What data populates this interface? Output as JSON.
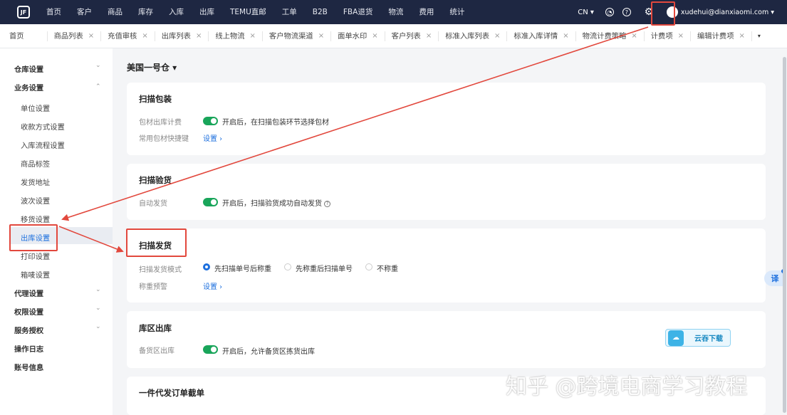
{
  "nav": {
    "logo_text": "JF",
    "items": [
      "首页",
      "客户",
      "商品",
      "库存",
      "入库",
      "出库",
      "TEMU直邮",
      "工单",
      "B2B",
      "FBA退货",
      "物流",
      "费用",
      "统计"
    ],
    "lang": "CN ▾",
    "user_email": "xudehui@dianxiaomi.com ▾"
  },
  "tabs": {
    "home": "首页",
    "items": [
      "商品列表",
      "充值审核",
      "出库列表",
      "线上物流",
      "客户物流渠道",
      "面单水印",
      "客户列表",
      "标准入库列表",
      "标准入库详情",
      "物流计费策略",
      "计费项",
      "编辑计费项"
    ],
    "close": "×",
    "more": "▾"
  },
  "sidebar": {
    "groups": {
      "warehouse": "仓库设置",
      "business": "业务设置",
      "agent": "代理设置",
      "permission": "权限设置",
      "service": "服务授权",
      "log": "操作日志",
      "account": "账号信息"
    },
    "business_items": [
      "单位设置",
      "收款方式设置",
      "入库流程设置",
      "商品标签",
      "发货地址",
      "波次设置",
      "移货设置",
      "出库设置",
      "打印设置",
      "箱唛设置"
    ],
    "chevron_down": "⌄",
    "chevron_up": "⌃"
  },
  "main": {
    "warehouse_select": "美国一号仓 ▾",
    "scan_pack": {
      "title": "扫描包装",
      "row1_label": "包材出库计费",
      "row1_text": "开启后，在扫描包装环节选择包材",
      "row2_label": "常用包材快捷键",
      "row2_link": "设置 ›"
    },
    "scan_check": {
      "title": "扫描验货",
      "row1_label": "自动发货",
      "row1_text": "开启后，扫描验货成功自动发货",
      "help": "?"
    },
    "scan_ship": {
      "title": "扫描发货",
      "mode_label": "扫描发货模式",
      "options": [
        "先扫描单号后称重",
        "先称重后扫描单号",
        "不称重"
      ],
      "selected": 0,
      "weight_label": "称重预警",
      "weight_link": "设置 ›"
    },
    "zone_out": {
      "title": "库区出库",
      "row1_label": "备货区出库",
      "row1_text": "开启后，允许备货区拣货出库"
    },
    "one_piece": {
      "title": "一件代发订单截单"
    }
  },
  "cloud_download": "云吞下载",
  "translate": "译",
  "watermark": "知乎 @跨境电商学习教程",
  "colors": {
    "nav_bg": "#1e2742",
    "accent": "#1c6fde",
    "toggle_on": "#19a55a",
    "annotation": "#e2483d"
  }
}
